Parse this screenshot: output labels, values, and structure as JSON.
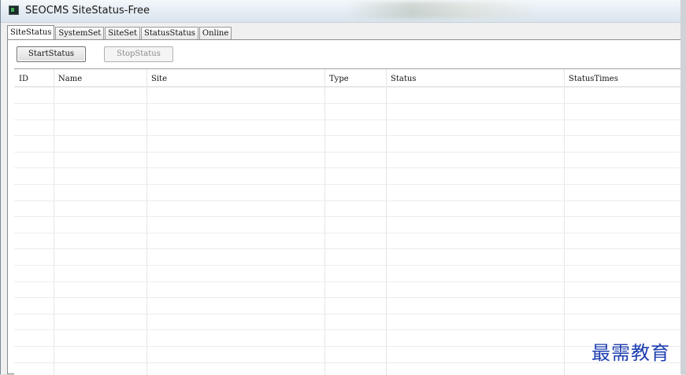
{
  "window": {
    "title": "SEOCMS SiteStatus-Free",
    "icon": "app-terminal-icon"
  },
  "tabs": [
    {
      "label": "SiteStatus",
      "active": true
    },
    {
      "label": "SystemSet",
      "active": false
    },
    {
      "label": "SiteSet",
      "active": false
    },
    {
      "label": "StatusStatus",
      "active": false
    },
    {
      "label": "Online",
      "active": false
    }
  ],
  "toolbar": {
    "start_label": "StartStatus",
    "stop_label": "StopStatus",
    "stop_enabled": false
  },
  "grid": {
    "columns": [
      "ID",
      "Name",
      "Site",
      "Type",
      "Status",
      "StatusTimes"
    ],
    "rows": []
  },
  "watermark": "最需教育"
}
